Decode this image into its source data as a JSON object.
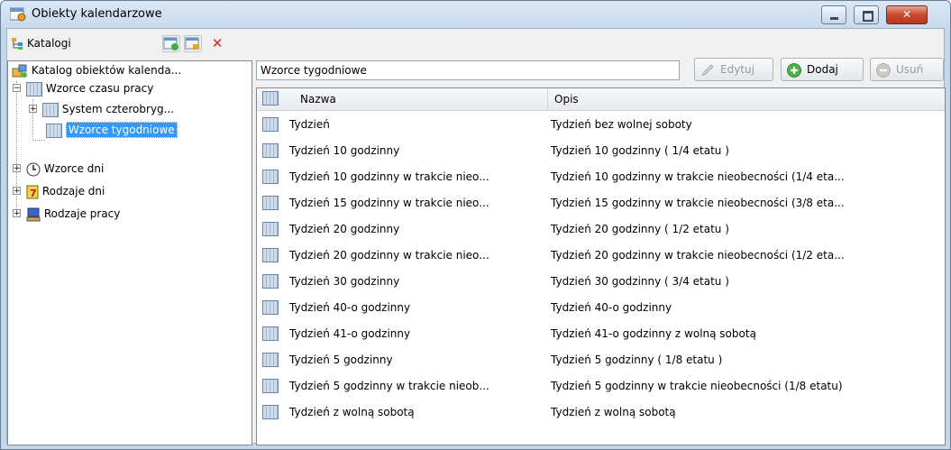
{
  "window": {
    "title": "Obiekty kalendarzowe"
  },
  "left": {
    "label": "Katalogi",
    "tree": {
      "root": "Katalog obiektów kalenda...",
      "n1": "Wzorce czasu pracy",
      "n1a": "System czterobryg...",
      "n1b": "Wzorce tygodniowe",
      "n2": "Wzorce dni",
      "n3": "Rodzaje dni",
      "n4": "Rodzaje pracy"
    }
  },
  "search": {
    "value": "Wzorce tygodniowe"
  },
  "actions": {
    "edit": "Edytuj",
    "add": "Dodaj",
    "delete": "Usuń"
  },
  "table": {
    "headers": {
      "name": "Nazwa",
      "desc": "Opis"
    },
    "rows": [
      {
        "name": "Tydzień",
        "desc": "Tydzień bez wolnej soboty"
      },
      {
        "name": "Tydzień 10 godzinny",
        "desc": "Tydzień 10 godzinny ( 1/4 etatu )"
      },
      {
        "name": "Tydzień 10 godzinny w trakcie nieo...",
        "desc": "Tydzień 10 godzinny w trakcie nieobecności (1/4 eta..."
      },
      {
        "name": "Tydzień 15 godzinny w trakcie nieo...",
        "desc": "Tydzień 15 godzinny w trakcie nieobecności (3/8 eta..."
      },
      {
        "name": "Tydzień 20 godzinny",
        "desc": "Tydzień 20 godzinny ( 1/2 etatu )"
      },
      {
        "name": "Tydzień 20 godzinny w trakcie nieo...",
        "desc": "Tydzień 20 godzinny w trakcie nieobecności (1/2 eta..."
      },
      {
        "name": "Tydzień 30 godzinny",
        "desc": "Tydzień 30 godzinny ( 3/4 etatu )"
      },
      {
        "name": "Tydzień 40-o godzinny",
        "desc": "Tydzień 40-o godzinny"
      },
      {
        "name": "Tydzień 41-o godzinny",
        "desc": "Tydzień 41-o godzinny z wolną sobotą"
      },
      {
        "name": "Tydzień 5 godzinny",
        "desc": "Tydzień 5 godzinny ( 1/8 etatu )"
      },
      {
        "name": "Tydzień 5 godzinny w trakcie nieob...",
        "desc": "Tydzień 5 godzinny w trakcie nieobecności (1/8 etatu)"
      },
      {
        "name": "Tydzień z wolną sobotą",
        "desc": "Tydzień z wolną sobotą"
      }
    ]
  }
}
